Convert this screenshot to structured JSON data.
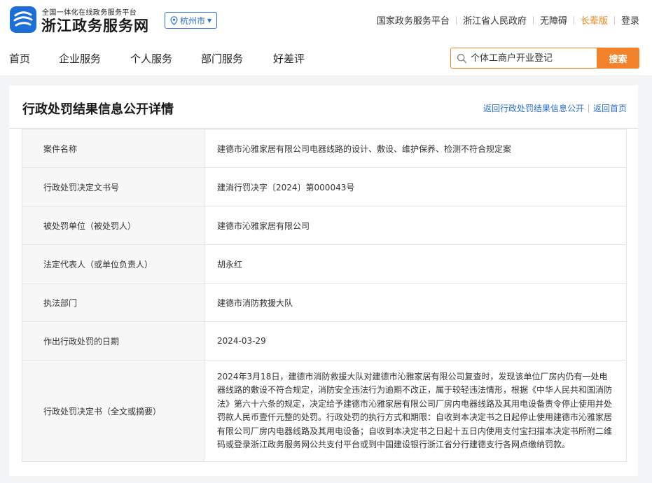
{
  "header": {
    "logo_subtitle": "全国一体化在线政务服务平台",
    "logo_title": "浙江政务服务网",
    "city": "杭州市",
    "links": [
      "国家政务服务平台",
      "浙江省人民政府",
      "无障碍",
      "长辈版",
      "登录"
    ],
    "accent_color": "#f08418"
  },
  "nav": {
    "items": [
      "首页",
      "企业服务",
      "个人服务",
      "部门服务",
      "好差评"
    ],
    "search_placeholder": "个体工商户开业登记",
    "search_button": "搜索"
  },
  "detail": {
    "title": "行政处罚结果信息公开详情",
    "link_back_list": "返回行政处罚结果信息公开",
    "link_home": "返回首页",
    "rows": [
      {
        "label": "案件名称",
        "value": "建德市沁雅家居有限公司电器线路的设计、敷设、维护保养、检测不符合规定案"
      },
      {
        "label": "行政处罚决定文书号",
        "value": "建消行罚决字〔2024〕第000043号"
      },
      {
        "label": "被处罚单位（被处罚人）",
        "value": "建德市沁雅家居有限公司"
      },
      {
        "label": "法定代表人（或单位负责人）",
        "value": "胡永红"
      },
      {
        "label": "执法部门",
        "value": "建德市消防救援大队"
      },
      {
        "label": "作出行政处罚的日期",
        "value": "2024-03-29"
      },
      {
        "label": "行政处罚决定书（全文或摘要）",
        "value": "2024年3月18日，建德市消防救援大队对建德市沁雅家居有限公司复查时，发现该单位厂房内仍有一处电器线路的敷设不符合规定，消防安全违法行为逾期不改正，属于较轻违法情形，根据《中华人民共和国消防法》第六十六条的规定，决定给予建德市沁雅家居有限公司厂房内电器线路及其用电设备责令停止使用并处罚款人民币壹仟元整的处罚。行政处罚的执行方式和期限：自收到本决定书之日起停止使用建德市沁雅家居有限公司厂房内电器线路及其用电设备；自收到本决定书之日起十五日内使用支付宝扫描本决定书所附二维码或登录浙江政务服务网公共支付平台或到中国建设银行浙江省分行建德支行各网点缴纳罚款。"
      }
    ]
  }
}
